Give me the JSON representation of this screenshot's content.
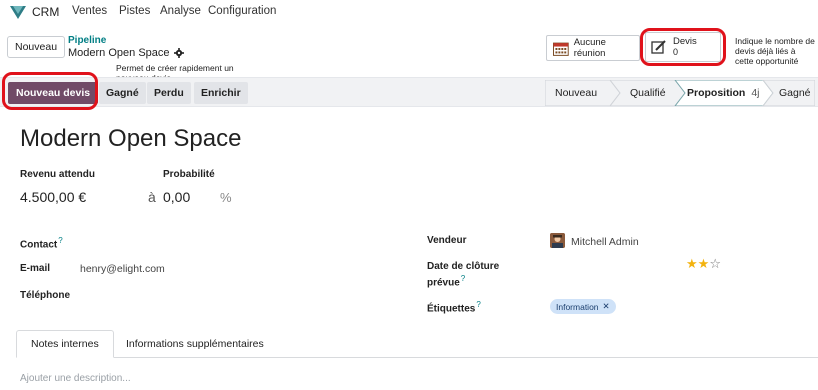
{
  "nav": {
    "app_name": "CRM",
    "menu": [
      "Ventes",
      "Pistes",
      "Analyse",
      "Configuration"
    ]
  },
  "control": {
    "new_button": "Nouveau",
    "breadcrumb_parent": "Pipeline",
    "breadcrumb_current": "Modern Open Space"
  },
  "callouts": {
    "new_quote_hint": "Permet de créer rapidement un nouveau devis",
    "devis_hint": "Indique le nombre de devis déjà liés à cette opportunité"
  },
  "smart_buttons": {
    "meeting_label": "Aucune réunion",
    "devis_label": "Devis",
    "devis_count": "0"
  },
  "header_buttons": {
    "new_quote": "Nouveau devis",
    "won": "Gagné",
    "lost": "Perdu",
    "enrich": "Enrichir"
  },
  "stages": [
    {
      "label": "Nouveau"
    },
    {
      "label": "Qualifié"
    },
    {
      "label": "Proposition",
      "days": "4j",
      "active": true
    },
    {
      "label": "Gagné"
    }
  ],
  "form": {
    "title": "Modern Open Space",
    "expected_revenue_label": "Revenu attendu",
    "expected_revenue_value": "4.500,00 €",
    "probability_label": "Probabilité",
    "probability_prefix": "à",
    "probability_value": "0,00",
    "probability_unit": "%",
    "contact_label": "Contact",
    "email_label": "E-mail",
    "email_value": "henry@elight.com",
    "phone_label": "Téléphone",
    "salesperson_label": "Vendeur",
    "salesperson_value": "Mitchell Admin",
    "closing_label_1": "Date de clôture",
    "closing_label_2": "prévue",
    "tags_label": "Étiquettes",
    "tag_value": "Information",
    "help_mark": "?",
    "priority_stars": 2,
    "priority_max": 3
  },
  "tabs": [
    {
      "label": "Notes internes",
      "active": true
    },
    {
      "label": "Informations supplémentaires",
      "active": false
    }
  ],
  "description_placeholder": "Ajouter une description...",
  "colors": {
    "primary": "#714b67",
    "accent": "#017e84",
    "highlight": "#e0121b",
    "star": "#f3b30f",
    "tag_bg": "#cfe2f8"
  }
}
